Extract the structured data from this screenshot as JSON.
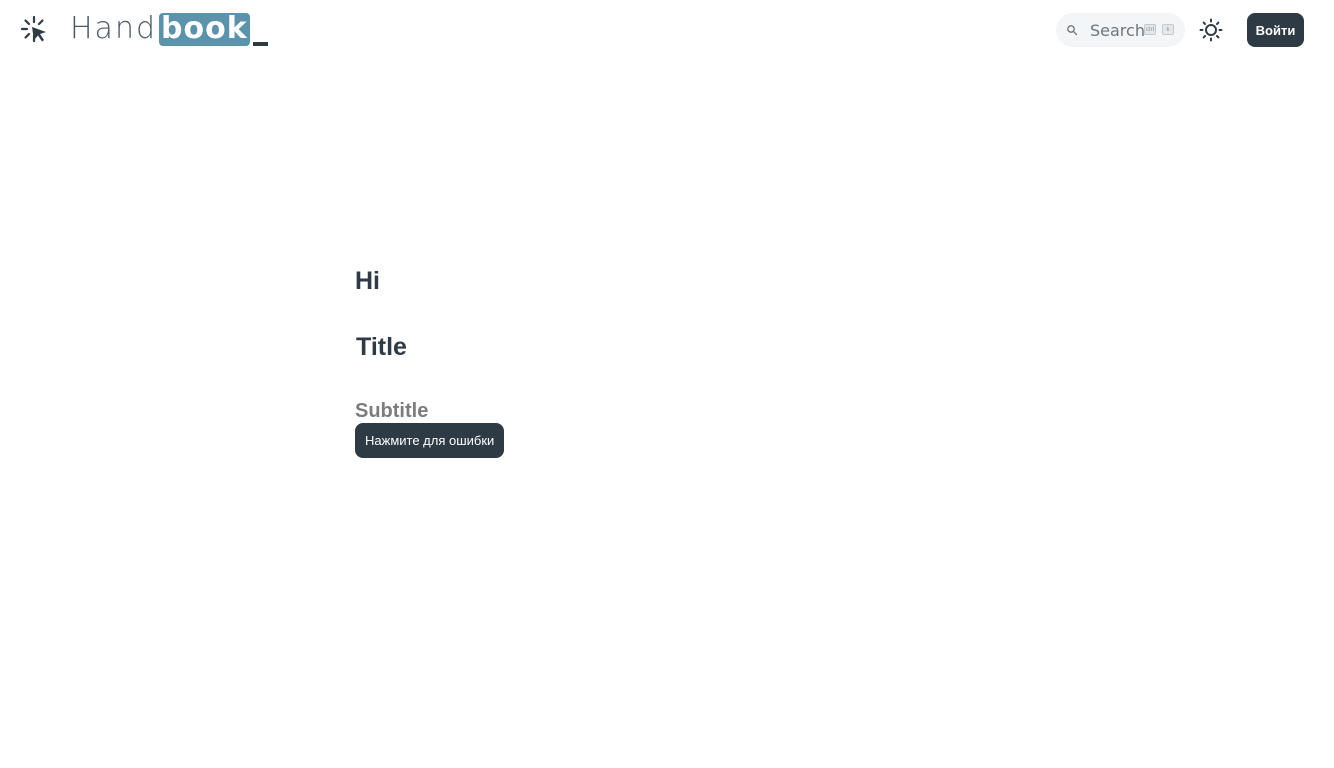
{
  "header": {
    "logo": {
      "icon": "sparkle-cursor-icon",
      "text_part1": "Hand",
      "text_part2": "book"
    },
    "search": {
      "icon": "search-icon",
      "label": "Search",
      "shortcut_keys": [
        "ctrl",
        "k"
      ]
    },
    "theme_toggle": {
      "icon": "sun-icon"
    },
    "login_label": "Войти"
  },
  "main": {
    "greeting": "Hi",
    "title": "Title",
    "subtitle": "Subtitle",
    "error_button_label": "Нажмите для ошибки"
  },
  "colors": {
    "accent": "#5b93ad",
    "dark": "#2e3a44",
    "subtitle": "#7c7c7c",
    "search_bg": "#f3f5f7"
  }
}
